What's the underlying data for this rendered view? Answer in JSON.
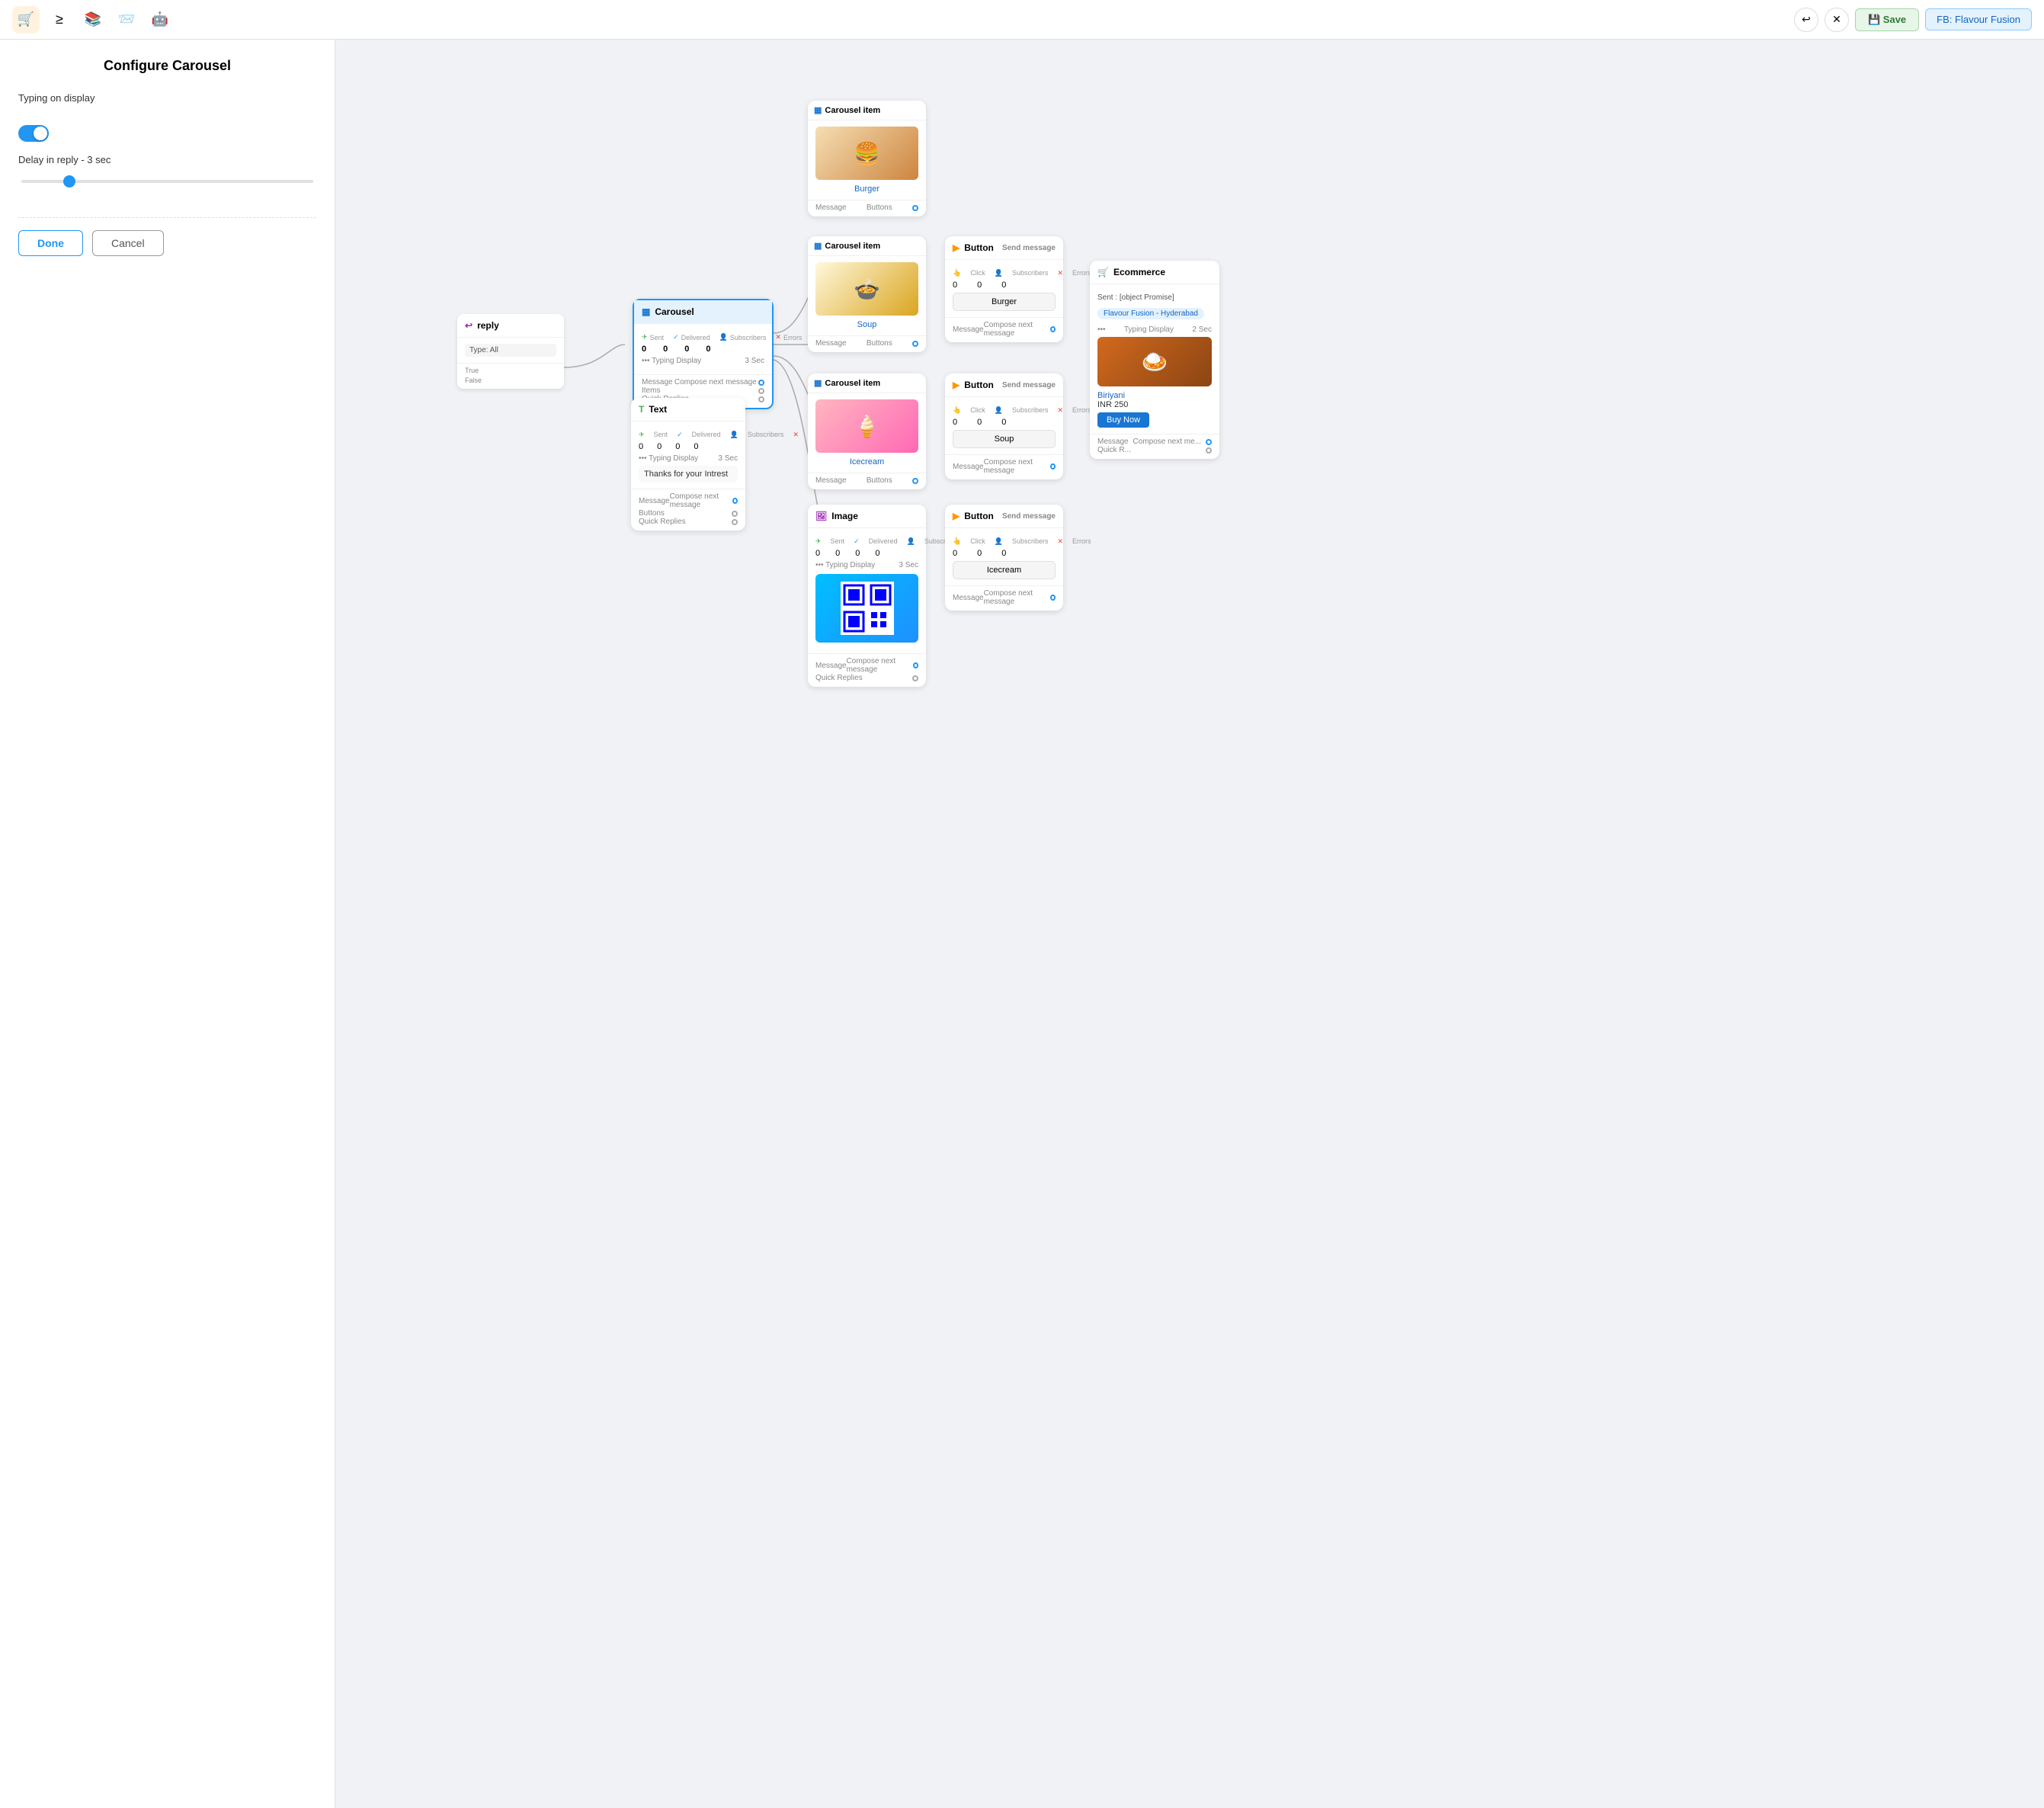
{
  "toolbar": {
    "save_label": "💾 Save",
    "fb_label": "FB: Flavour Fusion",
    "icons": [
      "🛒",
      "≥",
      "📚",
      "📨",
      "🤖"
    ]
  },
  "panel": {
    "title": "Configure Carousel",
    "typing_label": "Typing on display",
    "toggle_on": true,
    "delay_label": "Delay in reply  -  3 sec",
    "slider_value": 15,
    "btn_done": "Done",
    "btn_cancel": "Cancel"
  },
  "nodes": {
    "carousel": {
      "title": "Carousel",
      "stats": {
        "sent": "0",
        "delivered": "0",
        "subscribers": "0",
        "errors": "0"
      },
      "typing": "Typing Display",
      "delay": "3 Sec",
      "footer": {
        "message": "Message",
        "compose": "Compose next message",
        "items": "Items",
        "quick_replies": "Quick Replies"
      }
    },
    "ci_burger": {
      "title": "Carousel item",
      "food": "Burger"
    },
    "ci_soup": {
      "title": "Carousel item",
      "food": "Soup"
    },
    "ci_icecream": {
      "title": "Carousel item",
      "food": "Icecream"
    },
    "btn_burger": {
      "title": "Button",
      "send": "Send message",
      "stats": {
        "click": "0",
        "subscribers": "0",
        "errors": "0"
      },
      "label": "Burger"
    },
    "btn_soup": {
      "title": "Button",
      "send": "Send message",
      "stats": {
        "click": "0",
        "subscribers": "0",
        "errors": "0"
      },
      "label": "Soup"
    },
    "btn_icecream": {
      "title": "Button",
      "send": "Send message",
      "stats": {
        "click": "0",
        "subscribers": "0",
        "errors": "0"
      },
      "label": "Icecream"
    },
    "text_node": {
      "title": "Text",
      "stats": {
        "sent": "0",
        "delivered": "0",
        "subscribers": "0",
        "errors": "0"
      },
      "typing": "Typing Display",
      "delay": "3 Sec",
      "content": "Thanks for your Intrest"
    },
    "image_node": {
      "title": "Image",
      "stats": {
        "sent": "0",
        "delivered": "0",
        "subscribers": "0",
        "errors": "0"
      },
      "typing": "Typing Display",
      "delay": "3 Sec"
    },
    "ecomm_node": {
      "title": "Ecommerce",
      "promise": "Sent : [object Promise]",
      "tag": "Flavour Fusion - Hyderabad",
      "typing": "Typing Display",
      "delay": "2 Sec",
      "food": "Biriyani",
      "price": "INR 250",
      "buy_label": "Buy Now"
    }
  },
  "stats_labels": {
    "sent": "Sent",
    "delivered": "Delivered",
    "subscribers": "Subscribers",
    "errors": "Errors",
    "click": "Click"
  },
  "footer_labels": {
    "message": "Message",
    "compose": "Compose next message",
    "buttons": "Buttons",
    "quick_replies": "Quick Replies",
    "items": "Items"
  }
}
